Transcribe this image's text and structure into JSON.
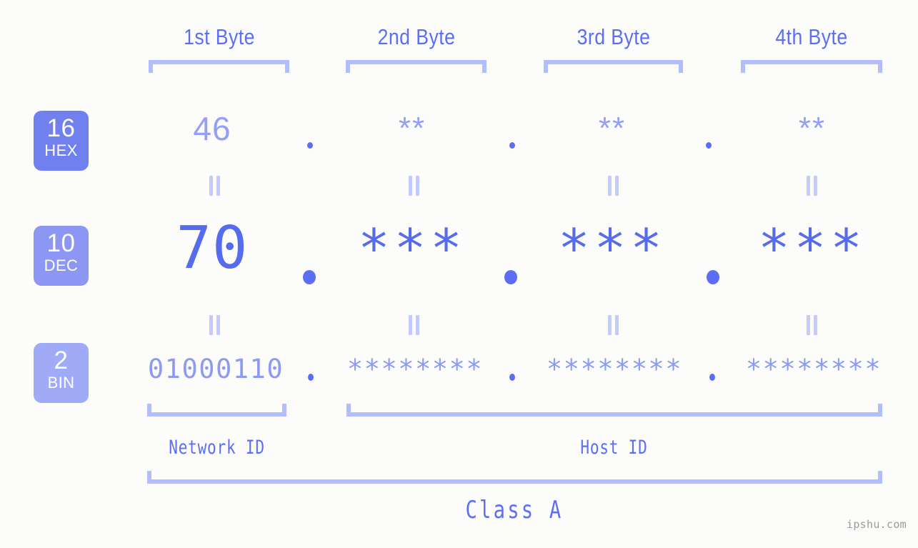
{
  "meta": {
    "background_color": "#fcfdfa",
    "accent_strong": "#5b6ef5",
    "accent_mid": "#8d9af3",
    "accent_light": "#b4bdfb",
    "watermark": "ipshu.com"
  },
  "byte_headers": [
    {
      "label": "1st Byte"
    },
    {
      "label": "2nd Byte"
    },
    {
      "label": "3rd Byte"
    },
    {
      "label": "4th Byte"
    }
  ],
  "radix_rows": [
    {
      "badge_number": "16",
      "badge_system": "HEX",
      "badge_color": "#7180ef",
      "values": [
        "46",
        "**",
        "**",
        "**"
      ],
      "separator": "."
    },
    {
      "badge_number": "10",
      "badge_system": "DEC",
      "badge_color": "#8b97f3",
      "values": [
        "70",
        "***",
        "***",
        "***"
      ],
      "separator": "."
    },
    {
      "badge_number": "2",
      "badge_system": "BIN",
      "badge_color": "#9fabf7",
      "values": [
        "01000110",
        "********",
        "********",
        "********"
      ],
      "separator": "."
    }
  ],
  "equivalence_symbol": "=",
  "id_labels": [
    {
      "label": "Network ID"
    },
    {
      "label": "Host ID"
    }
  ],
  "class_label": "Class A"
}
